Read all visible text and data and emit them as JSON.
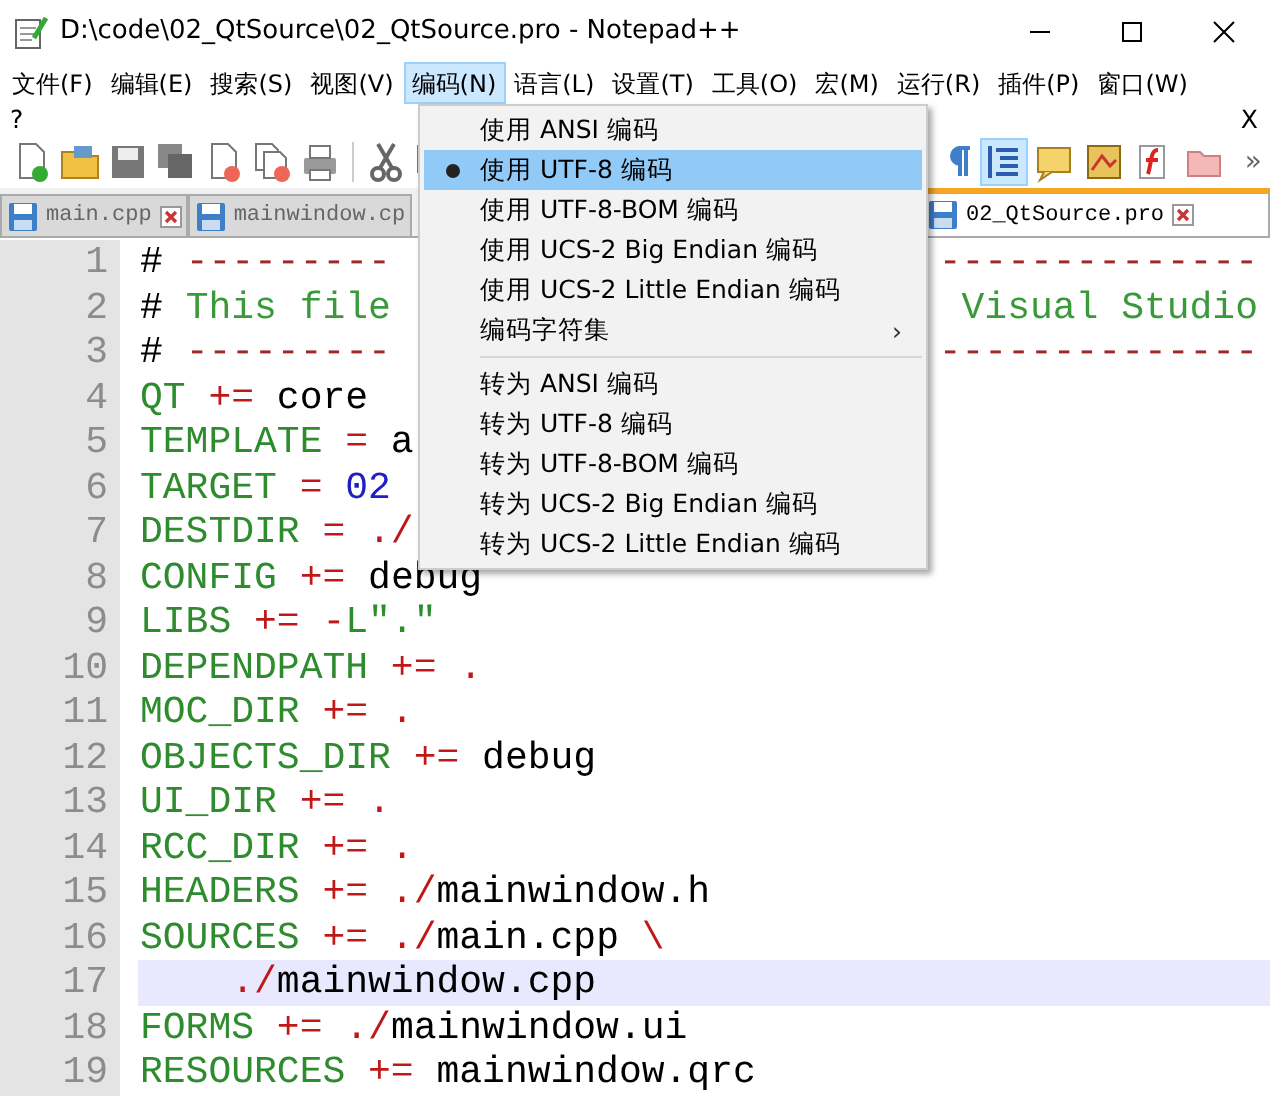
{
  "window": {
    "title": "D:\\code\\02_QtSource\\02_QtSource.pro - Notepad++"
  },
  "menubar": [
    {
      "label": "文件(F)",
      "selected": false
    },
    {
      "label": "编辑(E)",
      "selected": false
    },
    {
      "label": "搜索(S)",
      "selected": false
    },
    {
      "label": "视图(V)",
      "selected": false
    },
    {
      "label": "编码(N)",
      "selected": true
    },
    {
      "label": "语言(L)",
      "selected": false
    },
    {
      "label": "设置(T)",
      "selected": false
    },
    {
      "label": "工具(O)",
      "selected": false
    },
    {
      "label": "宏(M)",
      "selected": false
    },
    {
      "label": "运行(R)",
      "selected": false
    },
    {
      "label": "插件(P)",
      "selected": false
    },
    {
      "label": "窗口(W)",
      "selected": false
    }
  ],
  "help_row": {
    "label": "?",
    "close": "X"
  },
  "toolbar": {
    "overflow": "»"
  },
  "tabs": [
    {
      "label": "main.cpp",
      "selected": false
    },
    {
      "label": "mainwindow.cp",
      "selected": false
    },
    {
      "label": "02_QtSource.pro",
      "selected": true
    }
  ],
  "editor": {
    "lines": [
      {
        "number": "1",
        "current": false,
        "tokens": [
          {
            "kind": "plain",
            "text": "# "
          },
          {
            "kind": "rule",
            "text": "---------"
          }
        ],
        "end": [
          {
            "kind": "rule",
            "text": "--------------"
          }
        ]
      },
      {
        "number": "2",
        "current": false,
        "tokens": [
          {
            "kind": "plain",
            "text": "# "
          },
          {
            "kind": "comment",
            "text": "This file"
          }
        ],
        "end": [
          {
            "kind": "comment",
            "text": "Visual Studio"
          }
        ]
      },
      {
        "number": "3",
        "current": false,
        "tokens": [
          {
            "kind": "plain",
            "text": "# "
          },
          {
            "kind": "rule",
            "text": "---------"
          }
        ],
        "end": [
          {
            "kind": "rule",
            "text": "--------------"
          }
        ]
      },
      {
        "number": "4",
        "current": false,
        "tokens": [
          {
            "kind": "keyword",
            "text": "QT"
          },
          {
            "kind": "operator",
            "text": " +="
          },
          {
            "kind": "plain",
            "text": " core"
          }
        ]
      },
      {
        "number": "5",
        "current": false,
        "tokens": [
          {
            "kind": "keyword",
            "text": "TEMPLATE"
          },
          {
            "kind": "operator",
            "text": " ="
          },
          {
            "kind": "plain",
            "text": " a"
          }
        ]
      },
      {
        "number": "6",
        "current": false,
        "tokens": [
          {
            "kind": "keyword",
            "text": "TARGET"
          },
          {
            "kind": "operator",
            "text": " ="
          },
          {
            "kind": "number",
            "text": " 02"
          }
        ]
      },
      {
        "number": "7",
        "current": false,
        "tokens": [
          {
            "kind": "keyword",
            "text": "DESTDIR"
          },
          {
            "kind": "operator",
            "text": " = ./"
          }
        ]
      },
      {
        "number": "8",
        "current": false,
        "tokens": [
          {
            "kind": "keyword",
            "text": "CONFIG"
          },
          {
            "kind": "operator",
            "text": " +="
          },
          {
            "kind": "plain",
            "text": " debug"
          }
        ]
      },
      {
        "number": "9",
        "current": false,
        "tokens": [
          {
            "kind": "keyword",
            "text": "LIBS"
          },
          {
            "kind": "operator",
            "text": " += -"
          },
          {
            "kind": "keyword",
            "text": "L\".\""
          }
        ]
      },
      {
        "number": "10",
        "current": false,
        "tokens": [
          {
            "kind": "keyword",
            "text": "DEPENDPATH"
          },
          {
            "kind": "operator",
            "text": " += ."
          }
        ]
      },
      {
        "number": "11",
        "current": false,
        "tokens": [
          {
            "kind": "keyword",
            "text": "MOC_DIR"
          },
          {
            "kind": "operator",
            "text": " += ."
          }
        ]
      },
      {
        "number": "12",
        "current": false,
        "tokens": [
          {
            "kind": "keyword",
            "text": "OBJECTS_DIR"
          },
          {
            "kind": "operator",
            "text": " +="
          },
          {
            "kind": "plain",
            "text": " debug"
          }
        ]
      },
      {
        "number": "13",
        "current": false,
        "tokens": [
          {
            "kind": "keyword",
            "text": "UI_DIR"
          },
          {
            "kind": "operator",
            "text": " += ."
          }
        ]
      },
      {
        "number": "14",
        "current": false,
        "tokens": [
          {
            "kind": "keyword",
            "text": "RCC_DIR"
          },
          {
            "kind": "operator",
            "text": " += ."
          }
        ]
      },
      {
        "number": "15",
        "current": false,
        "tokens": [
          {
            "kind": "keyword",
            "text": "HEADERS"
          },
          {
            "kind": "operator",
            "text": " += ./"
          },
          {
            "kind": "plain",
            "text": "mainwindow.h"
          }
        ]
      },
      {
        "number": "16",
        "current": false,
        "tokens": [
          {
            "kind": "keyword",
            "text": "SOURCES"
          },
          {
            "kind": "operator",
            "text": " += ./"
          },
          {
            "kind": "plain",
            "text": "main.cpp"
          },
          {
            "kind": "operator",
            "text": " \\"
          }
        ]
      },
      {
        "number": "17",
        "current": true,
        "tokens": [
          {
            "kind": "operator",
            "text": "    ./"
          },
          {
            "kind": "plain",
            "text": "mainwindow.cpp"
          }
        ]
      },
      {
        "number": "18",
        "current": false,
        "tokens": [
          {
            "kind": "keyword",
            "text": "FORMS"
          },
          {
            "kind": "operator",
            "text": " += ./"
          },
          {
            "kind": "plain",
            "text": "mainwindow.ui"
          }
        ]
      },
      {
        "number": "19",
        "current": false,
        "tokens": [
          {
            "kind": "keyword",
            "text": "RESOURCES"
          },
          {
            "kind": "operator",
            "text": " +="
          },
          {
            "kind": "plain",
            "text": " mainwindow.qrc"
          }
        ]
      }
    ]
  },
  "menu": {
    "items": [
      {
        "kind": "item",
        "label": "使用 ANSI 编码",
        "selected": false
      },
      {
        "kind": "item",
        "label": "使用 UTF-8 编码",
        "selected": true
      },
      {
        "kind": "item",
        "label": "使用 UTF-8-BOM 编码",
        "selected": false
      },
      {
        "kind": "item",
        "label": "使用 UCS-2 Big Endian 编码",
        "selected": false
      },
      {
        "kind": "item",
        "label": "使用 UCS-2 Little Endian 编码",
        "selected": false
      },
      {
        "kind": "submenu",
        "label": "编码字符集",
        "arrow": "›",
        "selected": false
      },
      {
        "kind": "separator"
      },
      {
        "kind": "item",
        "label": "转为 ANSI 编码",
        "selected": false
      },
      {
        "kind": "item",
        "label": "转为 UTF-8 编码",
        "selected": false
      },
      {
        "kind": "item",
        "label": "转为 UTF-8-BOM 编码",
        "selected": false
      },
      {
        "kind": "item",
        "label": "转为 UCS-2 Big Endian 编码",
        "selected": false
      },
      {
        "kind": "item",
        "label": "转为 UCS-2 Little Endian 编码",
        "selected": false
      }
    ]
  }
}
